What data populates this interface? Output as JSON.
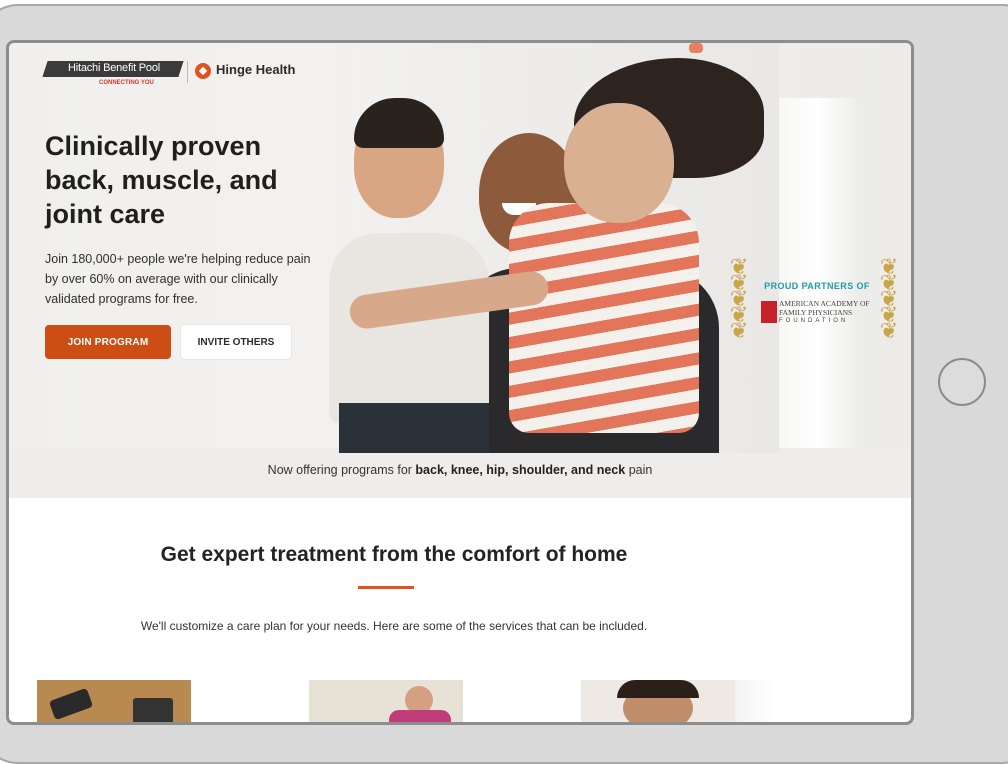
{
  "brand": {
    "hitachi_logo_text": "Hitachi Benefit Pool",
    "hitachi_tagline": "CONNECTING YOU",
    "hinge_logo_text": "Hinge Health",
    "accent_color": "#cc4e14"
  },
  "hero": {
    "headline": "Clinically proven back, muscle, and joint care",
    "subtext": "Join 180,000+ people we're helping reduce pain by over 60% on average with our clinically validated programs for free.",
    "join_button_label": "JOIN PROGRAM",
    "invite_button_label": "INVITE OTHERS"
  },
  "award": {
    "title": "PROUD PARTNERS OF",
    "org_line1": "AMERICAN ACADEMY OF",
    "org_line2": "FAMILY PHYSICIANS",
    "org_line3": "FOUNDATION"
  },
  "offering": {
    "prefix": "Now offering programs for ",
    "emphasis": "back, knee, hip, shoulder, and neck",
    "suffix": " pain"
  },
  "section": {
    "title": "Get expert treatment from the comfort of home",
    "subtitle": "We'll customize a care plan for your needs. Here are some of the services that can be included."
  },
  "icons": {
    "home_button": "home-button-icon",
    "hinge_logo": "hinge-logo-icon",
    "laurel": "laurel-icon"
  }
}
